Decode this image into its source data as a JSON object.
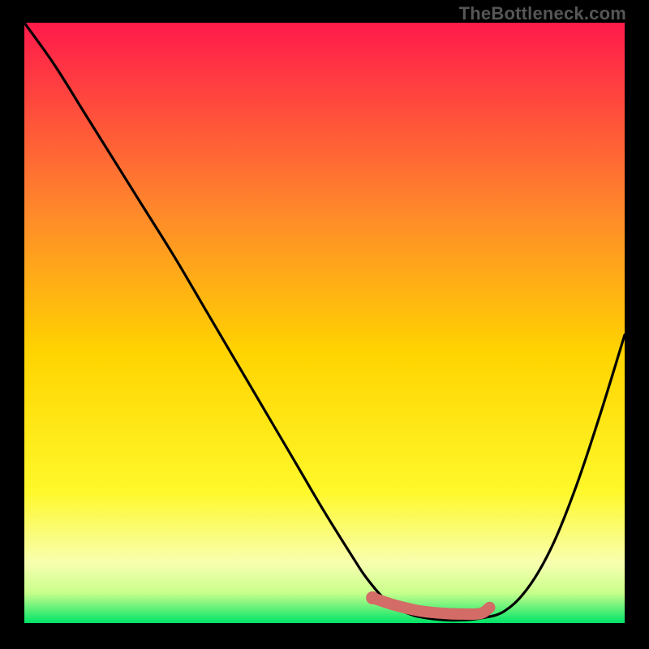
{
  "attribution": "TheBottleneck.com",
  "colors": {
    "gradient_top": "#ff1a4b",
    "gradient_upper": "#ff6a3a",
    "gradient_mid": "#ffc300",
    "gradient_lower": "#f7ff2e",
    "gradient_base_yellow": "#ffffb0",
    "gradient_base_green": "#00e468",
    "curve_stroke": "#000000",
    "marker_stroke": "#d36b66",
    "marker_fill": "#d36b66"
  },
  "chart_data": {
    "type": "line",
    "title": "",
    "xlabel": "",
    "ylabel": "",
    "xlim": [
      0,
      100
    ],
    "ylim": [
      0,
      100
    ],
    "series": [
      {
        "name": "bottleneck-curve",
        "x": [
          0,
          5,
          10,
          15,
          20,
          25,
          30,
          35,
          40,
          45,
          50,
          55,
          57,
          60,
          63,
          66,
          70,
          73,
          76,
          80,
          84,
          88,
          92,
          96,
          100
        ],
        "y": [
          100,
          93,
          85,
          77,
          69,
          61,
          52.5,
          44,
          35.5,
          27,
          18.5,
          10.5,
          7.5,
          4,
          2,
          1,
          0.5,
          0.5,
          0.8,
          2,
          6,
          13,
          23,
          35,
          48
        ]
      }
    ],
    "highlight": {
      "name": "optimal-range",
      "x": [
        58,
        62,
        66,
        70,
        73,
        76,
        77.5
      ],
      "y": [
        4.2,
        2.9,
        2.0,
        1.6,
        1.5,
        1.6,
        2.6
      ]
    },
    "highlight_start_point": {
      "x": 58,
      "y": 4.2
    }
  }
}
